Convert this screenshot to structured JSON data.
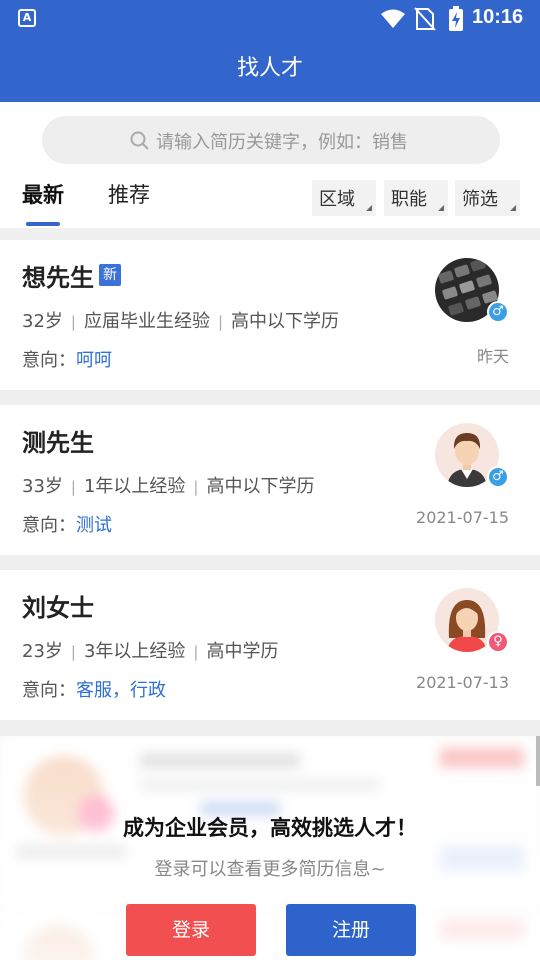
{
  "status_bar": {
    "time": "10:16"
  },
  "header": {
    "title": "找人才"
  },
  "search": {
    "placeholder": "请输入简历关键字，例如：销售"
  },
  "tabs": [
    {
      "label": "最新",
      "active": true
    },
    {
      "label": "推荐",
      "active": false
    }
  ],
  "filters": [
    {
      "label": "区域"
    },
    {
      "label": "职能"
    },
    {
      "label": "筛选"
    }
  ],
  "candidates": [
    {
      "name": "想先生",
      "badge": "新",
      "age": "32岁",
      "experience": "应届毕业生经验",
      "education": "高中以下学历",
      "intent_label": "意向：",
      "intent": "呵呵",
      "gender": "male",
      "gender_symbol": "♂",
      "date": "昨天",
      "avatar_icon": "keyboard-photo"
    },
    {
      "name": "测先生",
      "age": "33岁",
      "experience": "1年以上经验",
      "education": "高中以下学历",
      "intent_label": "意向：",
      "intent": "测试",
      "gender": "male",
      "gender_symbol": "♂",
      "date": "2021-07-15",
      "avatar_icon": "male-avatar"
    },
    {
      "name": "刘女士",
      "age": "23岁",
      "experience": "3年以上经验",
      "education": "高中学历",
      "intent_label": "意向：",
      "intent": "客服，行政",
      "gender": "female",
      "gender_symbol": "♀",
      "date": "2021-07-13",
      "avatar_icon": "female-avatar"
    }
  ],
  "promo": {
    "title": "成为企业会员，高效挑选人才！",
    "subtitle": "登录可以查看更多简历信息~",
    "login_label": "登录",
    "register_label": "注册"
  },
  "colors": {
    "brand": "#3366cc",
    "login": "#f25050",
    "link": "#2f6fd6"
  }
}
